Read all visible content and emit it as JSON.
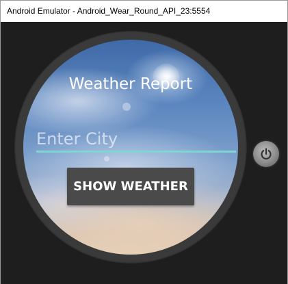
{
  "window": {
    "title": "Android Emulator - Android_Wear_Round_API_23:5554"
  },
  "app": {
    "heading": "Weather Report",
    "city_input": {
      "value": "",
      "placeholder": "Enter City"
    },
    "show_button_label": "SHOW WEATHER"
  },
  "emulator_controls": {
    "power_icon": "power-icon"
  },
  "colors": {
    "input_underline": "#7fd6d0",
    "button_bg": "#4a4a4a",
    "bezel": "#3a3a3a"
  }
}
